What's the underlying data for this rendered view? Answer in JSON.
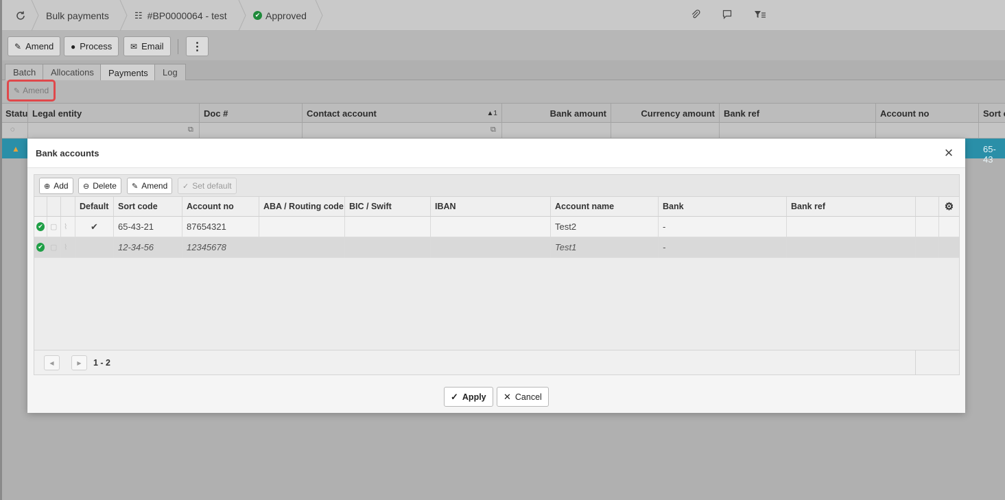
{
  "breadcrumb": {
    "module": "Bulk payments",
    "record": "#BP0000064 - test",
    "status": "Approved"
  },
  "toolbar": {
    "amend_label": "Amend",
    "process_label": "Process",
    "email_label": "Email",
    "more_label": "⋮"
  },
  "tabs": [
    {
      "label": "Batch"
    },
    {
      "label": "Allocations"
    },
    {
      "label": "Payments"
    },
    {
      "label": "Log"
    }
  ],
  "sub_toolbar": {
    "amend_label": "Amend"
  },
  "payments_grid": {
    "columns": [
      "Statu",
      "Legal entity",
      "Doc #",
      "Contact account",
      "Bank amount",
      "Currency amount",
      "Bank ref",
      "Account no",
      "Sort c"
    ],
    "sort_indicator": "▲1",
    "selected_row": {
      "sort_code_partial": "65-43"
    }
  },
  "modal": {
    "title": "Bank accounts",
    "close_icon": "×",
    "buttons": {
      "add": "Add",
      "delete": "Delete",
      "amend": "Amend",
      "set_default": "Set default"
    },
    "columns": [
      "Default",
      "Sort code",
      "Account no",
      "ABA / Routing code",
      "BIC / Swift",
      "IBAN",
      "Account name",
      "Bank",
      "Bank ref"
    ],
    "rows": [
      {
        "default": "✔",
        "sort_code": "65-43-21",
        "account_no": "87654321",
        "aba": "",
        "bic": "",
        "iban": "",
        "account_name": "Test2",
        "bank": "-",
        "bank_ref": ""
      },
      {
        "default": "",
        "sort_code": "12-34-56",
        "account_no": "12345678",
        "aba": "",
        "bic": "",
        "iban": "",
        "account_name": "Test1",
        "bank": "-",
        "bank_ref": ""
      }
    ],
    "pager": {
      "info": "1 - 2"
    },
    "apply_label": "Apply",
    "cancel_label": "Cancel"
  },
  "colors": {
    "accent_selected_row": "#2a8fa8",
    "status_ok": "#1f9f46",
    "highlight_border": "#e0484b"
  }
}
